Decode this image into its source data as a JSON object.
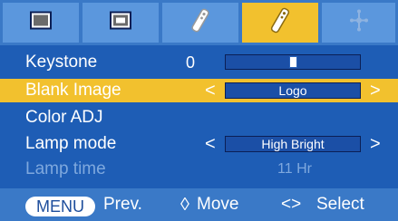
{
  "tabs": [
    {
      "icon": "picture-icon"
    },
    {
      "icon": "screen-icon"
    },
    {
      "icon": "remote-icon"
    },
    {
      "icon": "remote-settings-icon",
      "active": true
    },
    {
      "icon": "network-icon"
    }
  ],
  "menu": {
    "keystone": {
      "label": "Keystone",
      "value": "0",
      "level": 0.5
    },
    "blank_image": {
      "label": "Blank Image",
      "left_arrow": "<",
      "value": "Logo",
      "right_arrow": ">"
    },
    "color_adj": {
      "label": "Color ADJ"
    },
    "lamp_mode": {
      "label": "Lamp mode",
      "left_arrow": "<",
      "value": "High Bright",
      "right_arrow": ">"
    },
    "lamp_time": {
      "label": "Lamp time",
      "value": "11 Hr"
    }
  },
  "footer": {
    "menu_key": "MENU",
    "prev": "Prev.",
    "move_icon": "◊",
    "move": "Move",
    "select_icon": "<>",
    "select": "Select"
  },
  "colors": {
    "tabbar": "#3a79c7",
    "panel": "#1e5db5",
    "selected": "#f2c12e",
    "disabled_text": "#7ea8de"
  }
}
